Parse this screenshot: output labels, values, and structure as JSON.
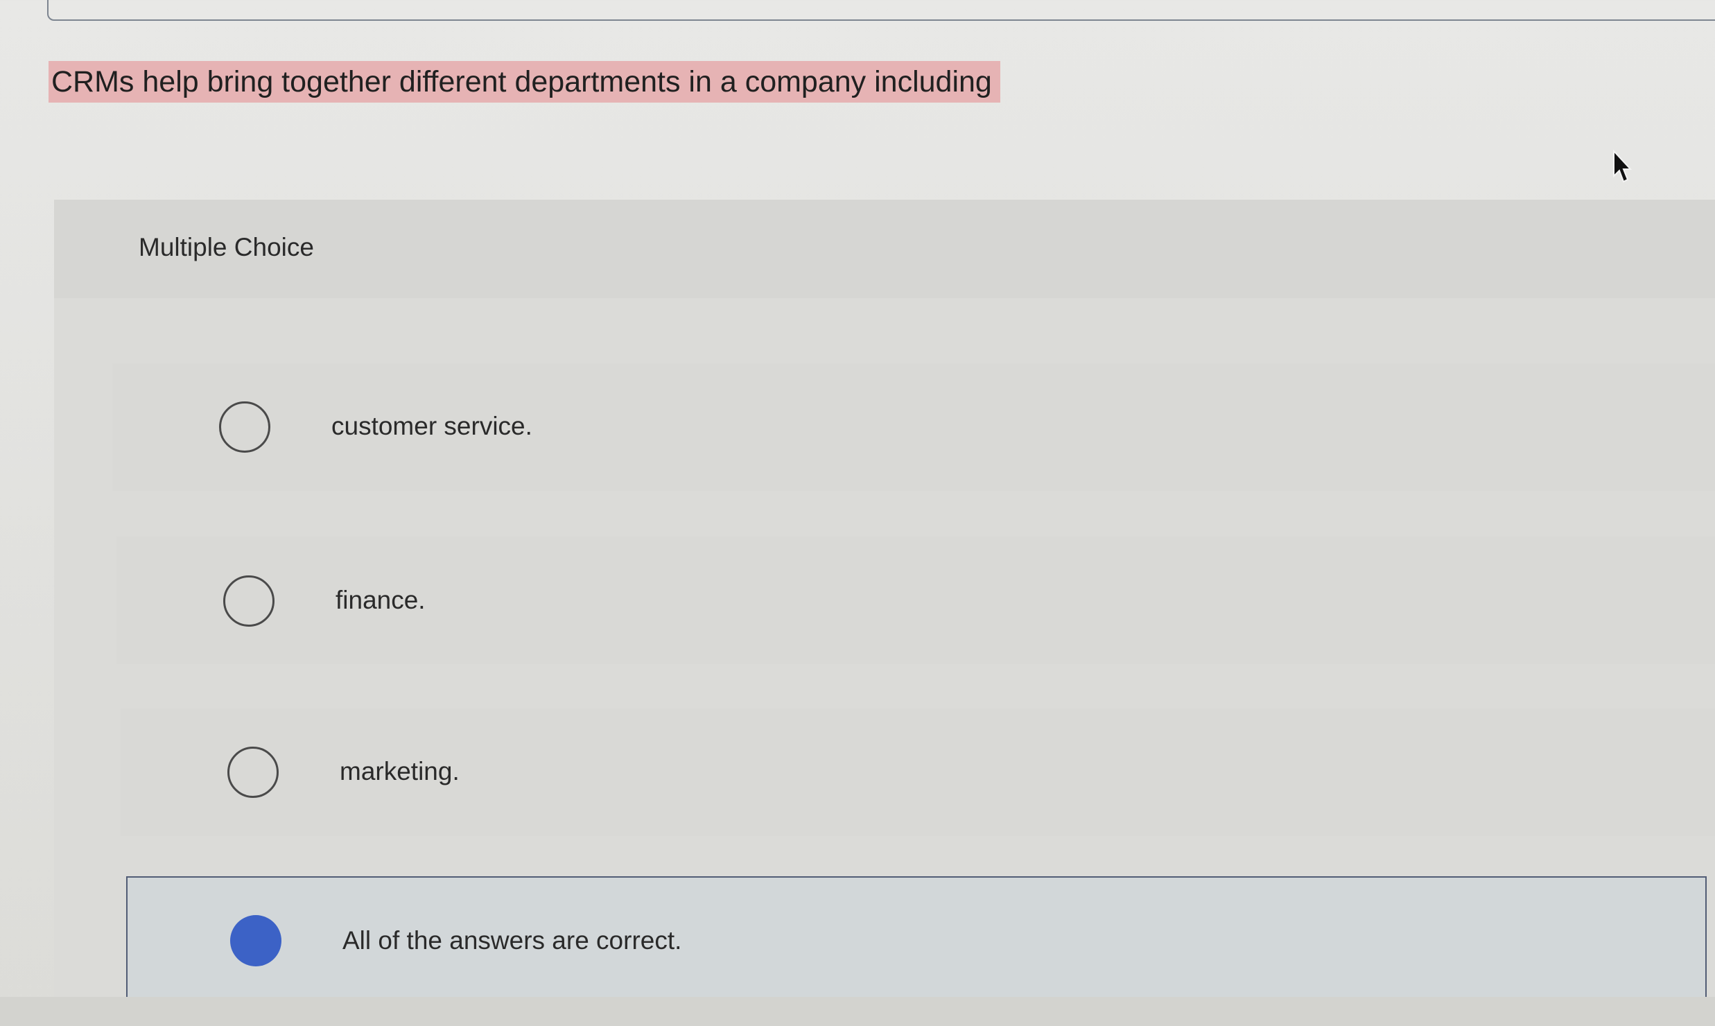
{
  "question": {
    "text": "CRMs help bring together different departments in a company including"
  },
  "question_type": {
    "label": "Multiple Choice"
  },
  "options": [
    {
      "label": "customer service.",
      "selected": false
    },
    {
      "label": "finance.",
      "selected": false
    },
    {
      "label": "marketing.",
      "selected": false
    },
    {
      "label": "All of the answers are correct.",
      "selected": true
    }
  ],
  "colors": {
    "highlight": "#e6b3b4",
    "selected_radio": "#3c62c6",
    "selected_border": "#515c75"
  },
  "icons": {
    "radio": "radio-button-icon",
    "cursor": "mouse-pointer-icon"
  }
}
